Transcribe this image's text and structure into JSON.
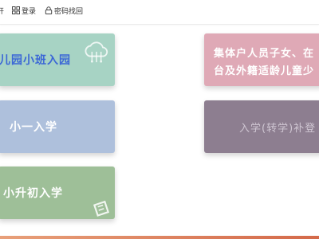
{
  "topbar": {
    "items": [
      {
        "label": "开",
        "icon": "user-icon"
      },
      {
        "label": "登录",
        "icon": "grid-icon"
      },
      {
        "label": "密码找回",
        "icon": "lock-icon"
      }
    ]
  },
  "cards": [
    {
      "id": "kindergarten",
      "label": "幼儿园小班入园",
      "bg": "#a7d3c4",
      "text": "#3b67d6",
      "deco": "cloud-upload-icon"
    },
    {
      "id": "primary",
      "label": "小一入学",
      "bg": "#aec0dc",
      "text": "#ffffff"
    },
    {
      "id": "junior",
      "label": "小升初入学",
      "bg": "#9ebf98",
      "text": "#ffffff",
      "deco": "document-icon"
    },
    {
      "id": "collective",
      "label_line1": "集体户人员子女、在",
      "label_line2": "台及外籍适龄儿童少",
      "bg": "#dfa9b6",
      "text": "#ffffff"
    },
    {
      "id": "transfer",
      "label": "入学(转学)补登",
      "bg": "#8d7e90",
      "text": "#cfc6d2"
    }
  ],
  "colors": {
    "bottom_strip_start": "#e8a07a",
    "bottom_strip_end": "#d46a4a"
  }
}
